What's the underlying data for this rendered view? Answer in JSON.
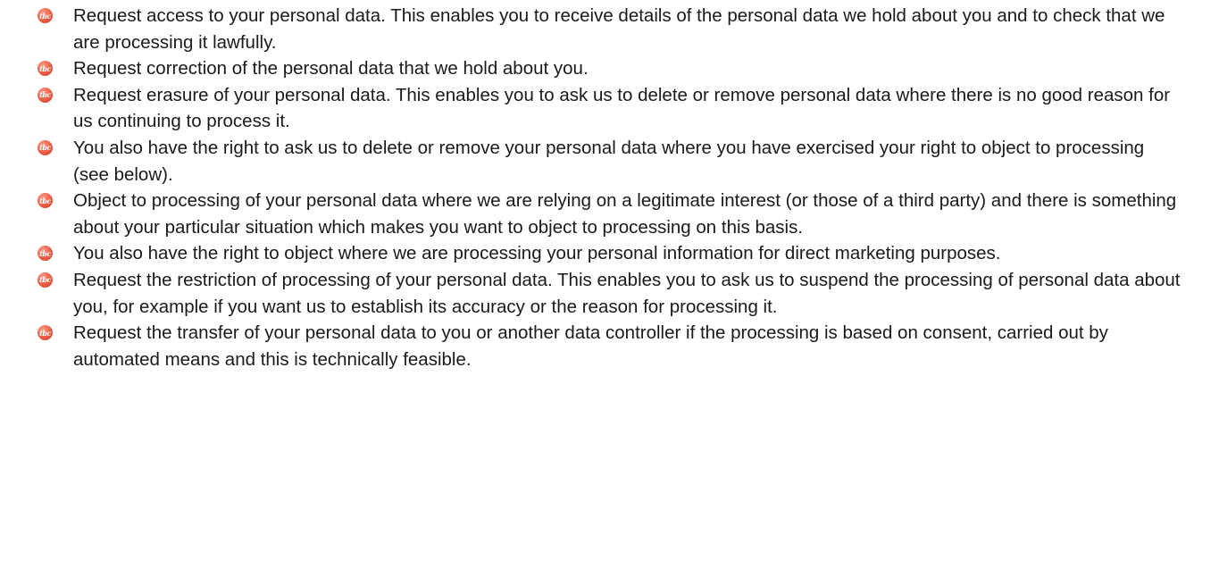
{
  "bullet_icon": {
    "name": "tbc-logo-bullet-icon",
    "text": "tbc",
    "color": "#ec5a44"
  },
  "items": [
    {
      "text": "Request access to your personal data. This enables you to receive details of the personal data we hold about you and to check that we are processing it lawfully."
    },
    {
      "text": "Request correction of the personal data that we hold about you."
    },
    {
      "text": "Request erasure of your personal data. This enables you to ask us to delete or remove personal data where there is no good reason for us continuing to process it."
    },
    {
      "text": "You also have the right to ask us to delete or remove your personal data where you have exercised your right to object to processing (see below)."
    },
    {
      "text": "Object to processing of your personal data where we are relying on a legitimate interest (or those of a third party) and there is something about your particular situation which makes you want to object to processing on this basis."
    },
    {
      "text": "You also have the right to object where we are processing your personal information for direct marketing purposes."
    },
    {
      "text": "Request the restriction of processing of your personal data. This enables you to ask us to suspend the processing of personal data about you, for example if you want us to establish its accuracy or the reason for processing it."
    },
    {
      "text": "Request the transfer of your personal data to you or another data controller if the processing is based on consent, carried out by automated means and this is technically feasible."
    }
  ]
}
